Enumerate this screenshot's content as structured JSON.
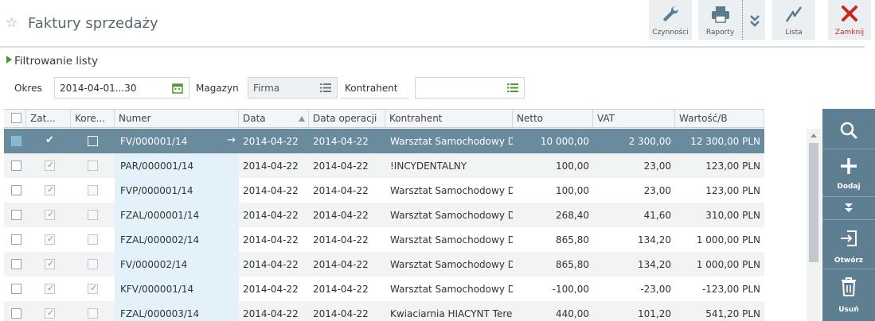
{
  "header": {
    "title": "Faktury sprzedaży",
    "buttons": {
      "czynnosci": "Czynności",
      "raporty": "Raporty",
      "lista": "Lista",
      "zamknij": "Zamknij"
    }
  },
  "filter": {
    "title": "Filtrowanie listy",
    "okres_label": "Okres",
    "okres_value": "2014-04-01...30",
    "magazyn_label": "Magazyn",
    "magazyn_value": "Firma",
    "kontrahent_label": "Kontrahent",
    "kontrahent_value": ""
  },
  "table": {
    "columns": [
      "Zat...",
      "Kore...",
      "Numer",
      "Data",
      "Data operacji",
      "Kontrahent",
      "Netto",
      "VAT",
      "Wartość/B"
    ],
    "rows": [
      {
        "zat": true,
        "kore": false,
        "numer": "FV/000001/14",
        "data": "2014-04-22",
        "data_op": "2014-04-22",
        "kontrahent": "Warsztat Samochodowy DR...",
        "netto": "10 000,00",
        "vat": "2 300,00",
        "wartosc": "12 300,00 PLN",
        "selected": true
      },
      {
        "zat": true,
        "kore": false,
        "numer": "PAR/000001/14",
        "data": "2014-04-22",
        "data_op": "2014-04-22",
        "kontrahent": "!INCYDENTALNY",
        "netto": "100,00",
        "vat": "23,00",
        "wartosc": "123,00 PLN"
      },
      {
        "zat": true,
        "kore": false,
        "numer": "FVP/000001/14",
        "data": "2014-04-22",
        "data_op": "2014-04-22",
        "kontrahent": "Warsztat Samochodowy DR...",
        "netto": "100,00",
        "vat": "23,00",
        "wartosc": "123,00 PLN"
      },
      {
        "zat": true,
        "kore": false,
        "numer": "FZAL/000001/14",
        "data": "2014-04-22",
        "data_op": "2014-04-22",
        "kontrahent": "Warsztat Samochodowy DR...",
        "netto": "268,40",
        "vat": "41,60",
        "wartosc": "310,00 PLN"
      },
      {
        "zat": true,
        "kore": false,
        "numer": "FZAL/000002/14",
        "data": "2014-04-22",
        "data_op": "2014-04-22",
        "kontrahent": "Warsztat Samochodowy DR...",
        "netto": "865,80",
        "vat": "134,20",
        "wartosc": "1 000,00 PLN"
      },
      {
        "zat": true,
        "kore": false,
        "numer": "FV/000002/14",
        "data": "2014-04-22",
        "data_op": "2014-04-22",
        "kontrahent": "Warsztat Samochodowy DR...",
        "netto": "865,80",
        "vat": "134,20",
        "wartosc": "1 000,00 PLN"
      },
      {
        "zat": true,
        "kore": true,
        "numer": "KFV/000001/14",
        "data": "2014-04-22",
        "data_op": "2014-04-22",
        "kontrahent": "Warsztat Samochodowy DR...",
        "netto": "-100,00",
        "vat": "-23,00",
        "wartosc": "-123,00 PLN"
      },
      {
        "zat": true,
        "kore": false,
        "numer": "FZAL/000003/14",
        "data": "2014-04-22",
        "data_op": "2014-04-22",
        "kontrahent": "Kwiaciarnia HIACYNT Teres...",
        "netto": "440,00",
        "vat": "101,20",
        "wartosc": "541,20 PLN"
      }
    ]
  },
  "side_panel": {
    "dodaj": "Dodaj",
    "otworz": "Otwórz",
    "usun": "Usuń"
  },
  "colors": {
    "selected_row": "#6a8a9d",
    "side_panel": "#5e7e91",
    "close_red": "#c62828",
    "numer_column": "#e3f2fa",
    "filter_green": "#4a9a2c"
  }
}
